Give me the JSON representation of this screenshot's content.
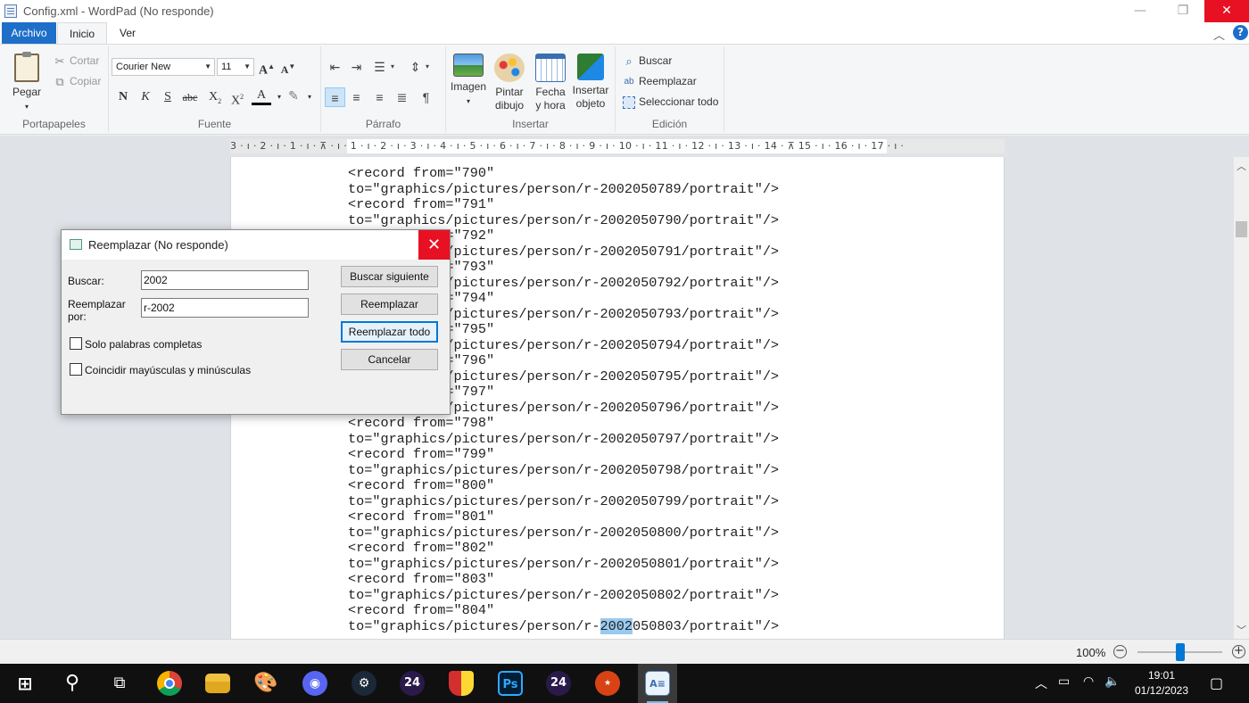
{
  "window": {
    "title": "Config.xml - WordPad (No responde)",
    "min_glyph": "—",
    "max_glyph": "❐",
    "close_glyph": "✕"
  },
  "tabs": {
    "archivo": "Archivo",
    "inicio": "Inicio",
    "ver": "Ver"
  },
  "ribbon": {
    "portapapeles": {
      "label": "Portapapeles",
      "pegar": "Pegar",
      "cortar": "Cortar",
      "copiar": "Copiar"
    },
    "fuente": {
      "label": "Fuente",
      "font_name": "Courier New",
      "font_size": "11"
    },
    "parrafo": {
      "label": "Párrafo"
    },
    "insertar": {
      "label": "Insertar",
      "imagen": "Imagen",
      "pintar_1": "Pintar",
      "pintar_2": "dibujo",
      "fecha_1": "Fecha",
      "fecha_2": "y hora",
      "objeto_1": "Insertar",
      "objeto_2": "objeto"
    },
    "edicion": {
      "label": "Edición",
      "buscar": "Buscar",
      "reemplazar": "Reemplazar",
      "seleccionar": "Seleccionar todo"
    }
  },
  "ruler": {
    "text": "3 · ı · 2 · ı · 1 · ı · ⊼ · ı · 1 · ı · 2 · ı · 3 · ı · 4 · ı · 5 · ı · 6 · ı · 7 · ı · 8 · ı · 9 · ı · 10 · ı · 11 · ı · 12 · ı · 13 · ı · 14 · ⊼ 15 · ı · 16 · ı · 17 · ı ·"
  },
  "document": {
    "lines_before_highlight": "<record from=\"790\"\nto=\"graphics/pictures/person/r-2002050789/portrait\"/>\n<record from=\"791\"\nto=\"graphics/pictures/person/r-2002050790/portrait\"/>\n<record from=\"792\"\nto=\"graphics/pictures/person/r-2002050791/portrait\"/>\n<record from=\"793\"\nto=\"graphics/pictures/person/r-2002050792/portrait\"/>\n<record from=\"794\"\nto=\"graphics/pictures/person/r-2002050793/portrait\"/>\n<record from=\"795\"\nto=\"graphics/pictures/person/r-2002050794/portrait\"/>\n<record from=\"796\"\nto=\"graphics/pictures/person/r-2002050795/portrait\"/>\n<record from=\"797\"\nto=\"graphics/pictures/person/r-2002050796/portrait\"/>\n<record from=\"798\"\nto=\"graphics/pictures/person/r-2002050797/portrait\"/>\n<record from=\"799\"\nto=\"graphics/pictures/person/r-2002050798/portrait\"/>\n<record from=\"800\"\nto=\"graphics/pictures/person/r-2002050799/portrait\"/>\n<record from=\"801\"\nto=\"graphics/pictures/person/r-2002050800/portrait\"/>\n<record from=\"802\"\nto=\"graphics/pictures/person/r-2002050801/portrait\"/>\n<record from=\"803\"\nto=\"graphics/pictures/person/r-2002050802/portrait\"/>\n<record from=\"804\"\nto=\"graphics/pictures/person/r-",
    "highlight": "2002",
    "lines_after_highlight": "050803/portrait\"/>"
  },
  "statusbar": {
    "zoom": "100%",
    "zoom_level_percent": 100
  },
  "taskbar": {
    "clock_time": "19:01",
    "clock_date": "01/12/2023",
    "icons": [
      "windows-start-icon",
      "search-icon",
      "task-view-icon",
      "chrome-icon",
      "file-explorer-icon",
      "paint-app-icon",
      "discord-icon",
      "steam-icon",
      "fifa-24-icon",
      "game-shield-icon",
      "photoshop-icon",
      "fc-24-icon",
      "game-badge-icon",
      "wordpad-icon"
    ],
    "fc24_label": "24",
    "ps_label": "Ps"
  },
  "dialog": {
    "title": "Reemplazar (No responde)",
    "buscar_label": "Buscar:",
    "buscar_value": "2002",
    "reemplazar_label_1": "Reemplazar",
    "reemplazar_label_2": "por:",
    "reemplazar_value": "r-2002",
    "solo_palabras": "Solo palabras completas",
    "coincidir": "Coincidir mayúsculas y minúsculas",
    "btn_buscar_siguiente": "Buscar siguiente",
    "btn_reemplazar": "Reemplazar",
    "btn_reemplazar_todo": "Reemplazar todo",
    "btn_cancelar": "Cancelar"
  },
  "colors": {
    "accent": "#1e6fc9",
    "close_red": "#e81123",
    "selection": "#99c9ef"
  }
}
